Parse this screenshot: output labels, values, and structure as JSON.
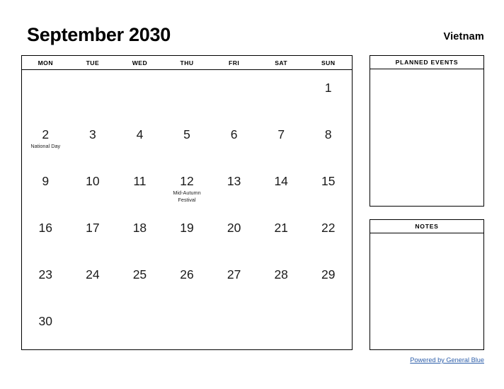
{
  "header": {
    "title": "September 2030",
    "country": "Vietnam"
  },
  "calendar": {
    "weekdays": [
      "MON",
      "TUE",
      "WED",
      "THU",
      "FRI",
      "SAT",
      "SUN"
    ],
    "weeks": [
      [
        {
          "day": ""
        },
        {
          "day": ""
        },
        {
          "day": ""
        },
        {
          "day": ""
        },
        {
          "day": ""
        },
        {
          "day": ""
        },
        {
          "day": "1"
        }
      ],
      [
        {
          "day": "2",
          "event": "National Day"
        },
        {
          "day": "3"
        },
        {
          "day": "4"
        },
        {
          "day": "5"
        },
        {
          "day": "6"
        },
        {
          "day": "7"
        },
        {
          "day": "8"
        }
      ],
      [
        {
          "day": "9"
        },
        {
          "day": "10"
        },
        {
          "day": "11"
        },
        {
          "day": "12",
          "event": "Mid-Autumn Festival"
        },
        {
          "day": "13"
        },
        {
          "day": "14"
        },
        {
          "day": "15"
        }
      ],
      [
        {
          "day": "16"
        },
        {
          "day": "17"
        },
        {
          "day": "18"
        },
        {
          "day": "19"
        },
        {
          "day": "20"
        },
        {
          "day": "21"
        },
        {
          "day": "22"
        }
      ],
      [
        {
          "day": "23"
        },
        {
          "day": "24"
        },
        {
          "day": "25"
        },
        {
          "day": "26"
        },
        {
          "day": "27"
        },
        {
          "day": "28"
        },
        {
          "day": "29"
        }
      ],
      [
        {
          "day": "30"
        },
        {
          "day": ""
        },
        {
          "day": ""
        },
        {
          "day": ""
        },
        {
          "day": ""
        },
        {
          "day": ""
        },
        {
          "day": ""
        }
      ]
    ]
  },
  "panels": {
    "planned_events": {
      "title": "PLANNED EVENTS",
      "content": ""
    },
    "notes": {
      "title": "NOTES",
      "content": ""
    }
  },
  "footer": {
    "link_text": "Powered by General Blue",
    "link_color": "#2e5faa"
  }
}
